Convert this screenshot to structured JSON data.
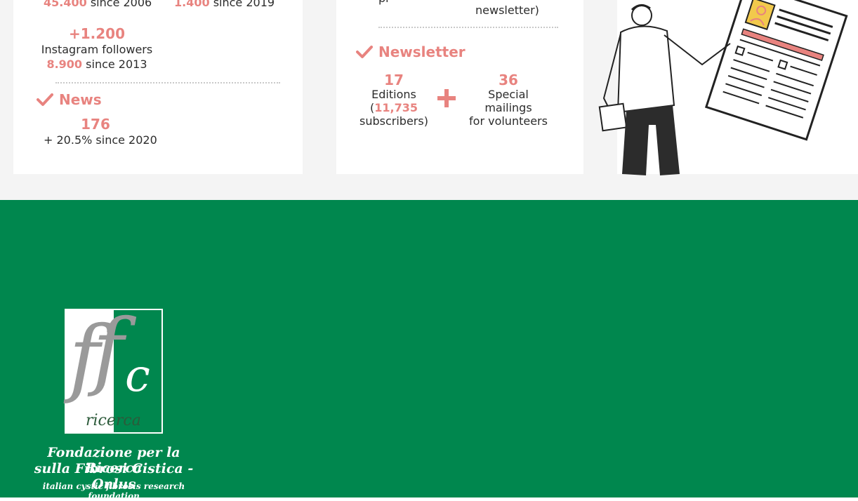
{
  "stats_card": {
    "row1": {
      "left_value": "45.400",
      "left_suffix": "since 2006",
      "right_value": "1.400",
      "right_suffix": "since 2019"
    },
    "instagram": {
      "growth": "+1.200",
      "label": "Instagram followers",
      "base_value": "8.900",
      "base_suffix": "since 2013"
    },
    "news": {
      "heading": "News",
      "value": "176",
      "growth": "+ 20.5% since 2020"
    }
  },
  "newsletter_card": {
    "top_fragment_left": "pr",
    "top_fragment_right": "newsletter)",
    "heading": "Newsletter",
    "editions": {
      "value": "17",
      "label": "Editions",
      "subscribers_open": "(",
      "subscribers_value": "11,735",
      "subscribers_label": "subscribers)"
    },
    "mailings": {
      "value": "36",
      "line1": "Special",
      "line2": "mailings",
      "line3": "for volunteers"
    }
  },
  "footer": {
    "logo_text": {
      "f1": "f",
      "f2": "f",
      "c": "c",
      "ricerca": "ricerca"
    },
    "foundation_line1": "Fondazione per la Ricerca",
    "foundation_line2": "sulla Fibrosi Cistica - Onlus",
    "foundation_line3": "italian cystic fibrosis research foundation"
  },
  "colors": {
    "accent": "#e8837f",
    "brand_green": "#00874e",
    "text_dark": "#2c2c2c",
    "background_gray": "#f4f4f4"
  },
  "icons": [
    "check-icon",
    "plus-icon",
    "newspaper-illustration",
    "ffc-logo"
  ]
}
